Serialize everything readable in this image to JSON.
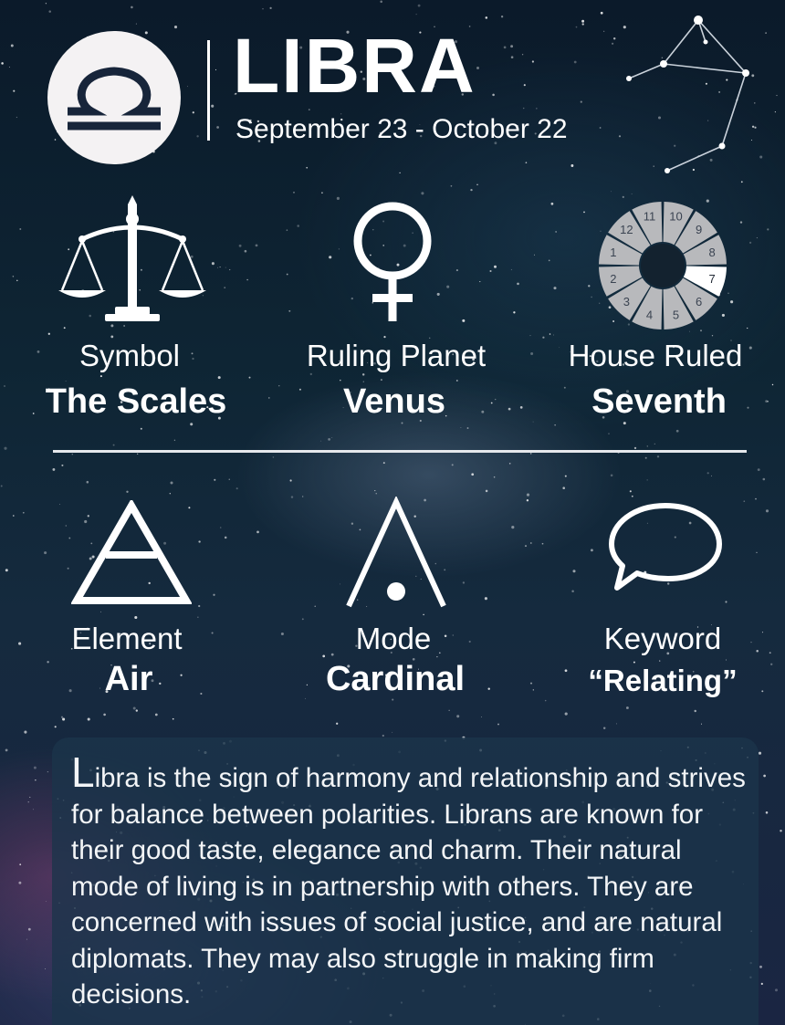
{
  "header": {
    "title": "LIBRA",
    "dates": "September 23 - October 22"
  },
  "facts": [
    {
      "label": "Symbol",
      "value": "The Scales",
      "icon": "scales-icon"
    },
    {
      "label": "Ruling Planet",
      "value": "Venus",
      "icon": "venus-icon"
    },
    {
      "label": "House Ruled",
      "value": "Seventh",
      "icon": "house-wheel-icon"
    },
    {
      "label": "Element",
      "value": "Air",
      "icon": "air-element-icon"
    },
    {
      "label": "Mode",
      "value": "Cardinal",
      "icon": "cardinal-mode-icon"
    },
    {
      "label": "Keyword",
      "value": "“Relating”",
      "icon": "speech-bubble-icon"
    }
  ],
  "house_wheel": {
    "numbers": [
      "1",
      "2",
      "3",
      "4",
      "5",
      "6",
      "7",
      "8",
      "9",
      "10",
      "11",
      "12"
    ],
    "highlighted": "7"
  },
  "description": {
    "initial": "L",
    "text": "ibra is the sign of harmony and relationship and strives for balance between polarities. Librans are known for their good taste, elegance and charm. Their natural mode of living is in partnership with others.  They are concerned with issues of social justice, and are natural diplomats.  They may also struggle in making firm decisions."
  },
  "colors": {
    "background": "#0e2534",
    "text": "#ffffff",
    "logo_circle": "#f4f2f3",
    "logo_glyph": "#17253a",
    "wheel_segment": "#b8b9bc",
    "wheel_highlight": "#ffffff",
    "description_box": "#1b344a"
  }
}
